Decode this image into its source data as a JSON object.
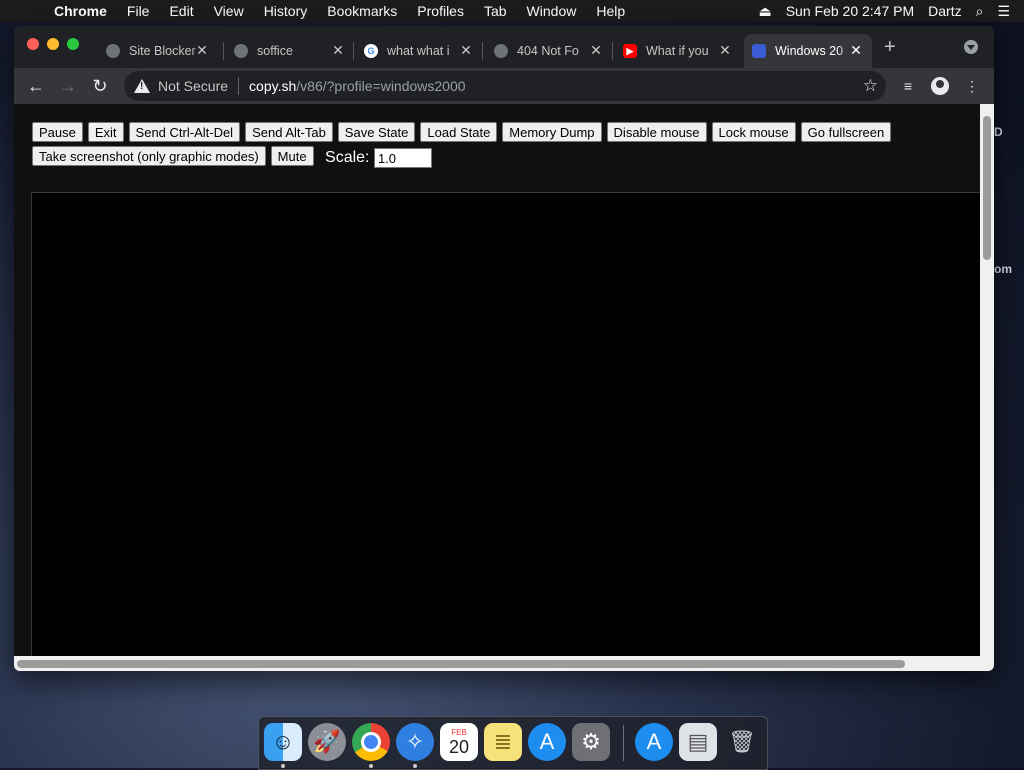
{
  "menubar": {
    "app": "Chrome",
    "items": [
      "File",
      "Edit",
      "View",
      "History",
      "Bookmarks",
      "Profiles",
      "Tab",
      "Window",
      "Help"
    ],
    "datetime": "Sun Feb 20  2:47 PM",
    "user": "Dartz"
  },
  "desktop": {
    "right_text_1": "D",
    "right_text_2": "om"
  },
  "tabs": [
    {
      "title": "Site Blocker",
      "icon": "globe-icon"
    },
    {
      "title": "soffice",
      "icon": "globe-icon"
    },
    {
      "title": "what what i",
      "icon": "google-icon"
    },
    {
      "title": "404 Not Fo",
      "icon": "globe-icon"
    },
    {
      "title": "What if you",
      "icon": "youtube-icon"
    },
    {
      "title": "Windows 20",
      "icon": "v86-icon",
      "active": true
    }
  ],
  "omnibox": {
    "security": "Not Secure",
    "host": "copy.sh",
    "path": "/v86/?profile=windows2000"
  },
  "controls": {
    "buttons": [
      "Pause",
      "Exit",
      "Send Ctrl-Alt-Del",
      "Send Alt-Tab",
      "Save State",
      "Load State",
      "Memory Dump",
      "Disable mouse",
      "Lock mouse",
      "Go fullscreen"
    ],
    "buttons_row2": [
      "Take screenshot (only graphic modes)",
      "Mute"
    ],
    "scale_label": "Scale:",
    "scale_value": "1.0"
  },
  "dock": {
    "apps": [
      "Finder",
      "Launchpad",
      "Google Chrome",
      "Safari",
      "Calendar",
      "Notes",
      "App Store",
      "System Preferences",
      "App Store",
      "Preview",
      "Trash"
    ],
    "calendar_month": "FEB",
    "calendar_day": "20"
  }
}
